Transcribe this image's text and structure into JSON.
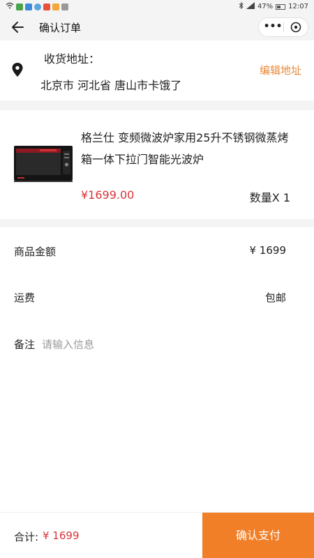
{
  "status_bar": {
    "battery": "47%",
    "time": "12:07"
  },
  "navbar": {
    "title": "确认订单",
    "more_label": "•••"
  },
  "address": {
    "label": "收货地址：",
    "text": "北京市 河北省 唐山市卡饿了",
    "edit_label": "编辑地址"
  },
  "product": {
    "title": "格兰仕 变频微波炉家用25升不锈钢微蒸烤箱一体下拉门智能光波炉",
    "price": "¥1699.00",
    "quantity": "数量X 1",
    "image_icon": "microwave-oven"
  },
  "summary": {
    "amount_label": "商品金额",
    "amount_value": "¥ 1699",
    "shipping_label": "运费",
    "shipping_value": "包邮",
    "note_label": "备注",
    "note_placeholder": "请输入信息",
    "note_value": ""
  },
  "footer": {
    "total_label": "合计:",
    "total_value": "¥ 1699",
    "pay_label": "确认支付"
  },
  "colors": {
    "accent": "#f07f28",
    "price": "#d8353a",
    "link": "#e8893b",
    "background": "#f4f4f4"
  }
}
